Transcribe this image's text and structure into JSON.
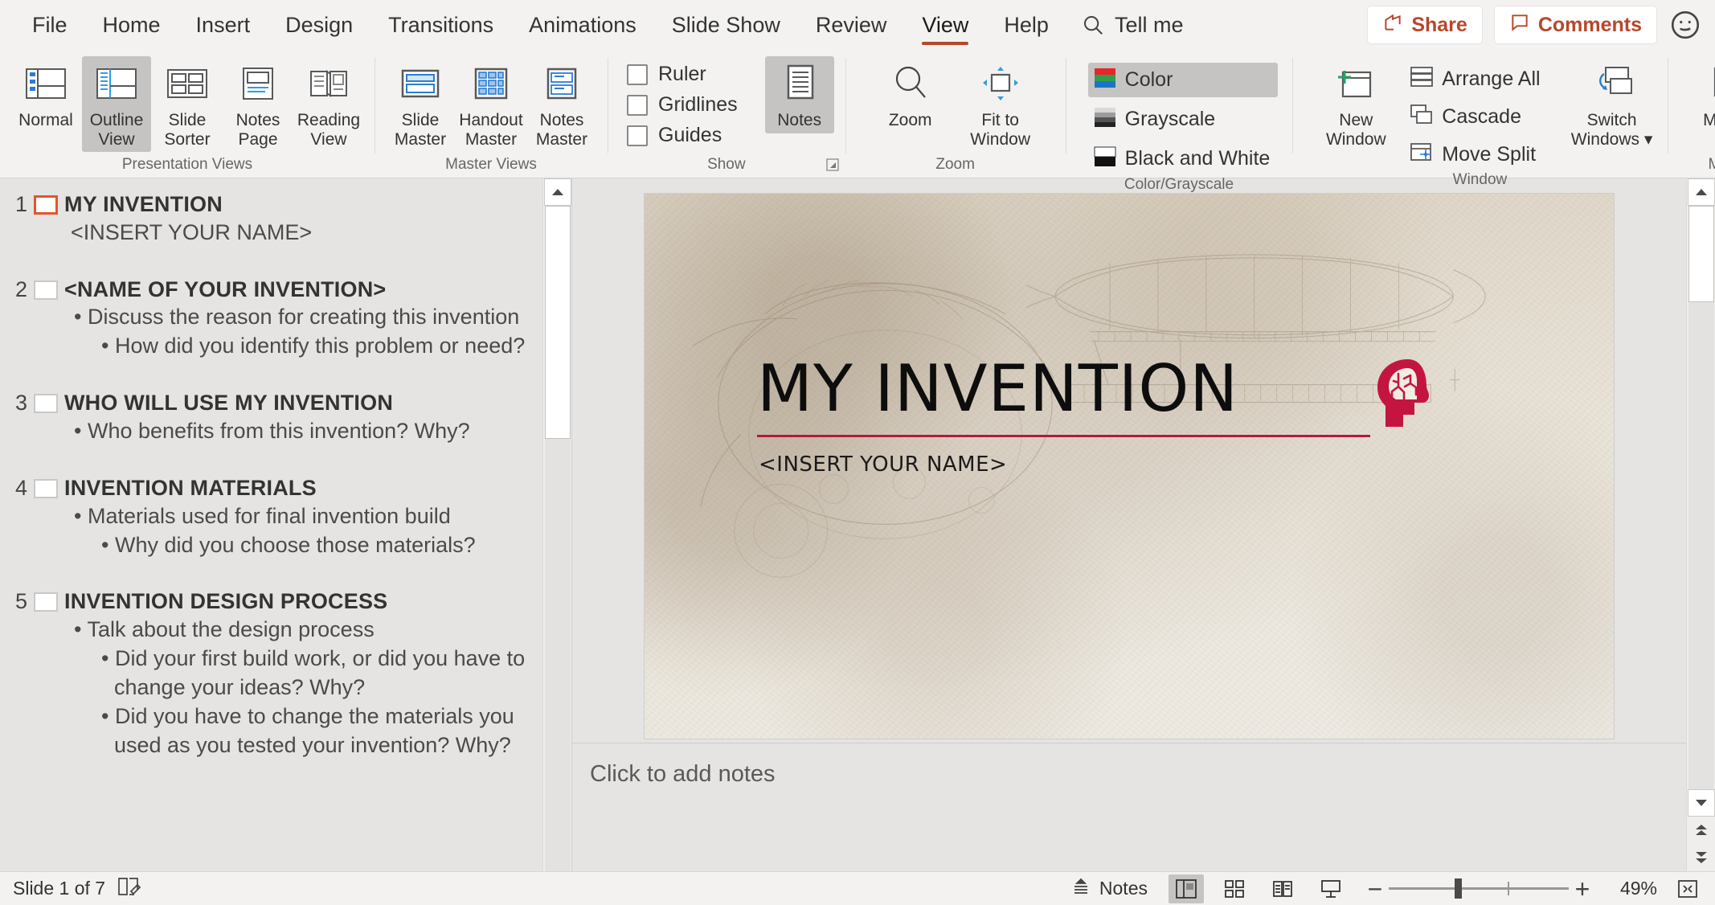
{
  "tabs": [
    {
      "label": "File",
      "active": false
    },
    {
      "label": "Home",
      "active": false
    },
    {
      "label": "Insert",
      "active": false
    },
    {
      "label": "Design",
      "active": false
    },
    {
      "label": "Transitions",
      "active": false
    },
    {
      "label": "Animations",
      "active": false
    },
    {
      "label": "Slide Show",
      "active": false
    },
    {
      "label": "Review",
      "active": false
    },
    {
      "label": "View",
      "active": true
    },
    {
      "label": "Help",
      "active": false
    }
  ],
  "tell_me": "Tell me",
  "share_label": "Share",
  "comments_label": "Comments",
  "ribbon": {
    "presentation_views": {
      "label": "Presentation Views",
      "buttons": [
        {
          "label": "Normal",
          "selected": false
        },
        {
          "label": "Outline View",
          "selected": true
        },
        {
          "label": "Slide Sorter",
          "selected": false
        },
        {
          "label": "Notes Page",
          "selected": false
        },
        {
          "label": "Reading View",
          "selected": false
        }
      ]
    },
    "master_views": {
      "label": "Master Views",
      "buttons": [
        {
          "label": "Slide Master",
          "selected": false
        },
        {
          "label": "Handout Master",
          "selected": false
        },
        {
          "label": "Notes Master",
          "selected": false
        }
      ]
    },
    "show": {
      "label": "Show",
      "checkboxes": [
        {
          "label": "Ruler",
          "checked": false
        },
        {
          "label": "Gridlines",
          "checked": false
        },
        {
          "label": "Guides",
          "checked": false
        }
      ],
      "notes_label": "Notes",
      "notes_selected": true
    },
    "zoom": {
      "label": "Zoom",
      "buttons": [
        {
          "label": "Zoom",
          "selected": false
        },
        {
          "label": "Fit to Window",
          "selected": false
        }
      ]
    },
    "color_grayscale": {
      "label": "Color/Grayscale",
      "items": [
        {
          "label": "Color",
          "selected": true
        },
        {
          "label": "Grayscale",
          "selected": false
        },
        {
          "label": "Black and White",
          "selected": false
        }
      ]
    },
    "window": {
      "label": "Window",
      "new_window": "New Window",
      "items": [
        {
          "label": "Arrange All"
        },
        {
          "label": "Cascade"
        },
        {
          "label": "Move Split"
        }
      ],
      "switch_windows": "Switch Windows"
    },
    "macros": {
      "label": "Macros",
      "button": "Macros"
    }
  },
  "outline": {
    "slides": [
      {
        "number": "1",
        "title": "MY INVENTION",
        "selected": true,
        "sub": "<INSERT YOUR NAME>",
        "level1": [],
        "level2": []
      },
      {
        "number": "2",
        "title": "<NAME OF YOUR INVENTION>",
        "selected": false,
        "sub": "",
        "level1": [
          "Discuss the reason for creating this invention"
        ],
        "level2": [
          "How did you identify this problem or need?"
        ]
      },
      {
        "number": "3",
        "title": "WHO WILL USE MY INVENTION",
        "selected": false,
        "sub": "",
        "level1": [
          "Who benefits from this invention? Why?"
        ],
        "level2": []
      },
      {
        "number": "4",
        "title": "INVENTION MATERIALS",
        "selected": false,
        "sub": "",
        "level1": [
          "Materials used for final invention build"
        ],
        "level2": [
          "Why did you choose those materials?"
        ]
      },
      {
        "number": "5",
        "title": "INVENTION DESIGN PROCESS",
        "selected": false,
        "sub": "",
        "level1": [
          "Talk about the design process"
        ],
        "level2": [
          "Did your first build work, or did you have to change your ideas? Why?",
          "Did you have to change the materials you used as you tested your invention? Why?"
        ]
      }
    ]
  },
  "slide": {
    "title": "MY INVENTION",
    "subtitle": "<INSERT YOUR NAME>",
    "accent_color": "#b01b3e",
    "logo_icon": "head-brain-icon"
  },
  "notes_placeholder": "Click to add notes",
  "status": {
    "slide_indicator": "Slide 1 of 7",
    "notes_label": "Notes",
    "zoom_percent": "49%",
    "view_buttons": [
      {
        "name": "normal-view",
        "selected": true
      },
      {
        "name": "slide-sorter-view",
        "selected": false
      },
      {
        "name": "reading-view",
        "selected": false
      },
      {
        "name": "slideshow-view",
        "selected": false
      }
    ]
  }
}
